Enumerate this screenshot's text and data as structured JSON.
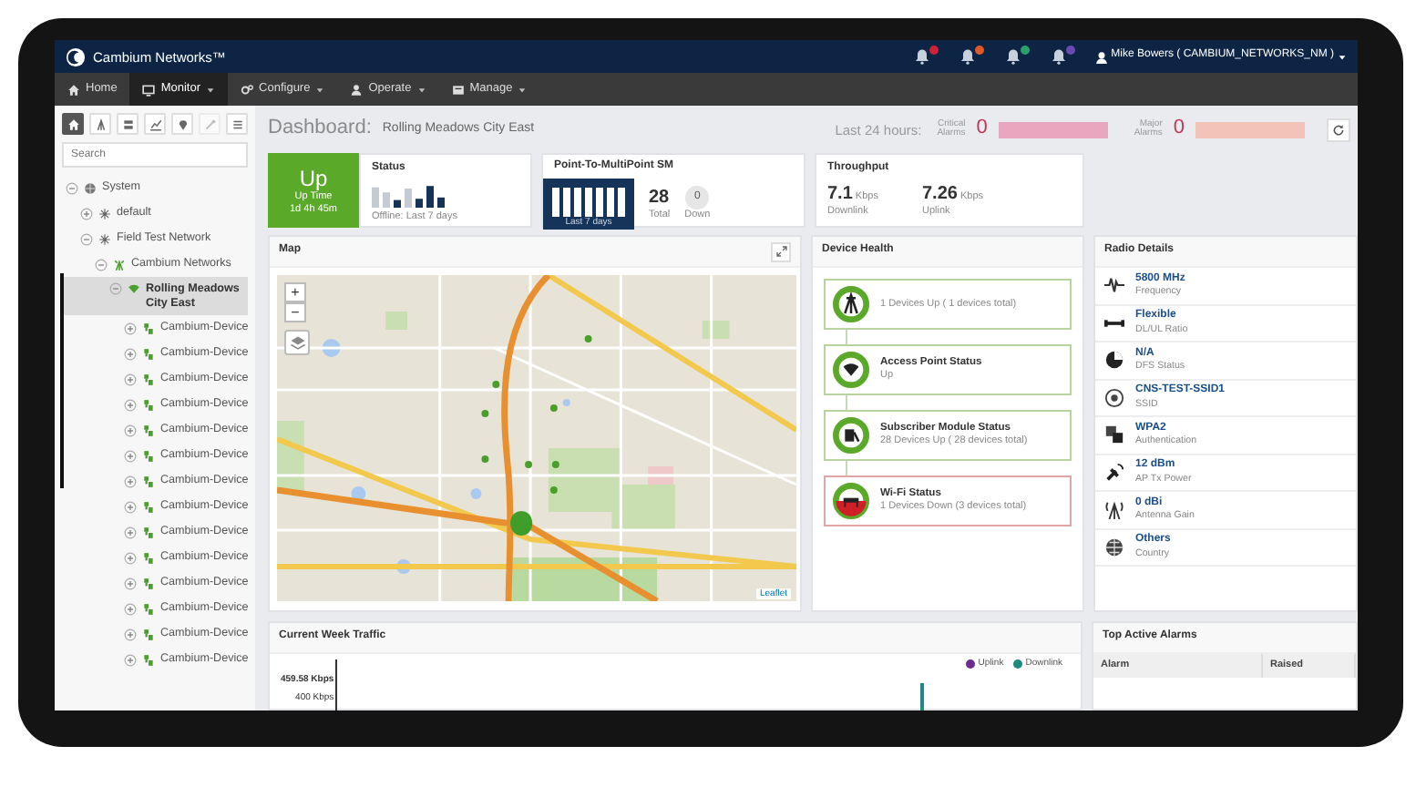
{
  "header": {
    "brand": "Cambium Networks™",
    "notifications": [
      {
        "color": "#d0203a"
      },
      {
        "color": "#e0592a"
      },
      {
        "color": "#2aa06a"
      },
      {
        "color": "#6a4bb5"
      }
    ],
    "user": "Mike Bowers ( CAMBIUM_NETWORKS_NM )"
  },
  "nav": [
    {
      "label": "Home",
      "kind": "home",
      "dropdown": false,
      "selected": false
    },
    {
      "label": "Monitor",
      "kind": "monitor",
      "dropdown": true,
      "selected": true
    },
    {
      "label": "Configure",
      "kind": "configure",
      "dropdown": true,
      "selected": false
    },
    {
      "label": "Operate",
      "kind": "operate",
      "dropdown": true,
      "selected": false
    },
    {
      "label": "Manage",
      "kind": "manage",
      "dropdown": true,
      "selected": false
    }
  ],
  "sidebar": {
    "tools": [
      {
        "kind": "home",
        "selected": true,
        "disabled": false
      },
      {
        "kind": "tower",
        "selected": false,
        "disabled": false
      },
      {
        "kind": "server",
        "selected": false,
        "disabled": false
      },
      {
        "kind": "chart",
        "selected": false,
        "disabled": false
      },
      {
        "kind": "pin",
        "selected": false,
        "disabled": false
      },
      {
        "kind": "wrench",
        "selected": false,
        "disabled": true
      },
      {
        "kind": "list",
        "selected": false,
        "disabled": false
      }
    ],
    "search": {
      "placeholder": "Search"
    },
    "tree": [
      {
        "label": "System",
        "kind": "system",
        "expanded": true,
        "selected": false,
        "children": [
          {
            "label": "default",
            "kind": "network",
            "expanded": false,
            "selected": false
          },
          {
            "label": "Field Test Network",
            "kind": "network",
            "expanded": true,
            "selected": false,
            "children": [
              {
                "label": "Cambium Networks",
                "kind": "tower",
                "expanded": true,
                "selected": false,
                "children": [
                  {
                    "label": "Rolling Meadows City East",
                    "kind": "wifi",
                    "expanded": true,
                    "selected": true,
                    "children": [
                      {
                        "label": "Cambium-Device",
                        "kind": "device",
                        "expanded": false,
                        "selected": false
                      },
                      {
                        "label": "Cambium-Device",
                        "kind": "device",
                        "expanded": false,
                        "selected": false
                      },
                      {
                        "label": "Cambium-Device",
                        "kind": "device",
                        "expanded": false,
                        "selected": false
                      },
                      {
                        "label": "Cambium-Device",
                        "kind": "device",
                        "expanded": false,
                        "selected": false
                      },
                      {
                        "label": "Cambium-Device",
                        "kind": "device",
                        "expanded": false,
                        "selected": false
                      },
                      {
                        "label": "Cambium-Device",
                        "kind": "device",
                        "expanded": false,
                        "selected": false
                      },
                      {
                        "label": "Cambium-Device",
                        "kind": "device",
                        "expanded": false,
                        "selected": false
                      },
                      {
                        "label": "Cambium-Device",
                        "kind": "device",
                        "expanded": false,
                        "selected": false
                      },
                      {
                        "label": "Cambium-Device",
                        "kind": "device",
                        "expanded": false,
                        "selected": false
                      },
                      {
                        "label": "Cambium-Device",
                        "kind": "device",
                        "expanded": false,
                        "selected": false
                      },
                      {
                        "label": "Cambium-Device",
                        "kind": "device",
                        "expanded": false,
                        "selected": false
                      },
                      {
                        "label": "Cambium-Device",
                        "kind": "device",
                        "expanded": false,
                        "selected": false
                      },
                      {
                        "label": "Cambium-Device",
                        "kind": "device",
                        "expanded": false,
                        "selected": false
                      },
                      {
                        "label": "Cambium-Device",
                        "kind": "device",
                        "expanded": false,
                        "selected": false
                      }
                    ]
                  }
                ]
              }
            ]
          }
        ]
      }
    ]
  },
  "dashboard": {
    "title": "Dashboard:",
    "subtitle": "Rolling Meadows City East",
    "period": "Last 24 hours:",
    "alarms": [
      {
        "label": "Critical Alarms",
        "count": "0",
        "color": "#e8a6bf"
      },
      {
        "label": "Major Alarms",
        "count": "0",
        "color": "#f3c2b8"
      }
    ]
  },
  "status_tile": {
    "state": "Up",
    "label": "Up Time",
    "value": "1d 4h 45m",
    "healthy": true
  },
  "status_card": {
    "title": "Status",
    "caption": "Offline: Last 7 days"
  },
  "ptmp": {
    "title": "Point-To-MultiPoint SM",
    "caption": "Last 7 days",
    "total": "28",
    "total_label": "Total",
    "down": "0",
    "down_label": "Down"
  },
  "throughput": {
    "title": "Throughput",
    "items": [
      {
        "value": "7.1",
        "unit": "Kbps",
        "label": "Downlink"
      },
      {
        "value": "7.26",
        "unit": "Kbps",
        "label": "Uplink"
      }
    ]
  },
  "map": {
    "title": "Map",
    "zoom_in": "+",
    "zoom_out": "−",
    "attribution": "Leaflet"
  },
  "device_health": {
    "title": "Device Health",
    "items": [
      {
        "kind": "tower",
        "detail": "1 Devices Up ( 1 devices total)",
        "healthy": true
      },
      {
        "kind": "access-point",
        "title": "Access Point Status",
        "detail": "Up",
        "healthy": true
      },
      {
        "kind": "subscriber",
        "title": "Subscriber Module Status",
        "detail": "28 Devices Up ( 28 devices total)",
        "healthy": true
      },
      {
        "kind": "wifi",
        "title": "Wi-Fi Status",
        "detail": "1 Devices Down (3 devices total)",
        "healthy": false
      }
    ]
  },
  "radio_details": {
    "title": "Radio Details",
    "items": [
      {
        "kind": "frequency",
        "value": "5800 MHz",
        "label": "Frequency"
      },
      {
        "kind": "ratio",
        "value": "Flexible",
        "label": "DL/UL Ratio"
      },
      {
        "kind": "dfs",
        "value": "N/A",
        "label": "DFS Status"
      },
      {
        "kind": "ssid",
        "value": "CNS-TEST-SSID1",
        "label": "SSID"
      },
      {
        "kind": "auth",
        "value": "WPA2",
        "label": "Authentication"
      },
      {
        "kind": "power",
        "value": "12 dBm",
        "label": "AP Tx Power"
      },
      {
        "kind": "antenna",
        "value": "0 dBi",
        "label": "Antenna Gain"
      },
      {
        "kind": "country",
        "value": "Others",
        "label": "Country"
      }
    ]
  },
  "traffic": {
    "title": "Current Week Traffic",
    "axis_labels": [
      "459.58 Kbps",
      "400 Kbps"
    ],
    "legend": [
      {
        "label": "Uplink",
        "color": "#6b2c91"
      },
      {
        "label": "Downlink",
        "color": "#1f8a80"
      }
    ]
  },
  "alarms_table": {
    "title": "Top Active Alarms",
    "columns": [
      "Alarm",
      "Raised"
    ]
  }
}
